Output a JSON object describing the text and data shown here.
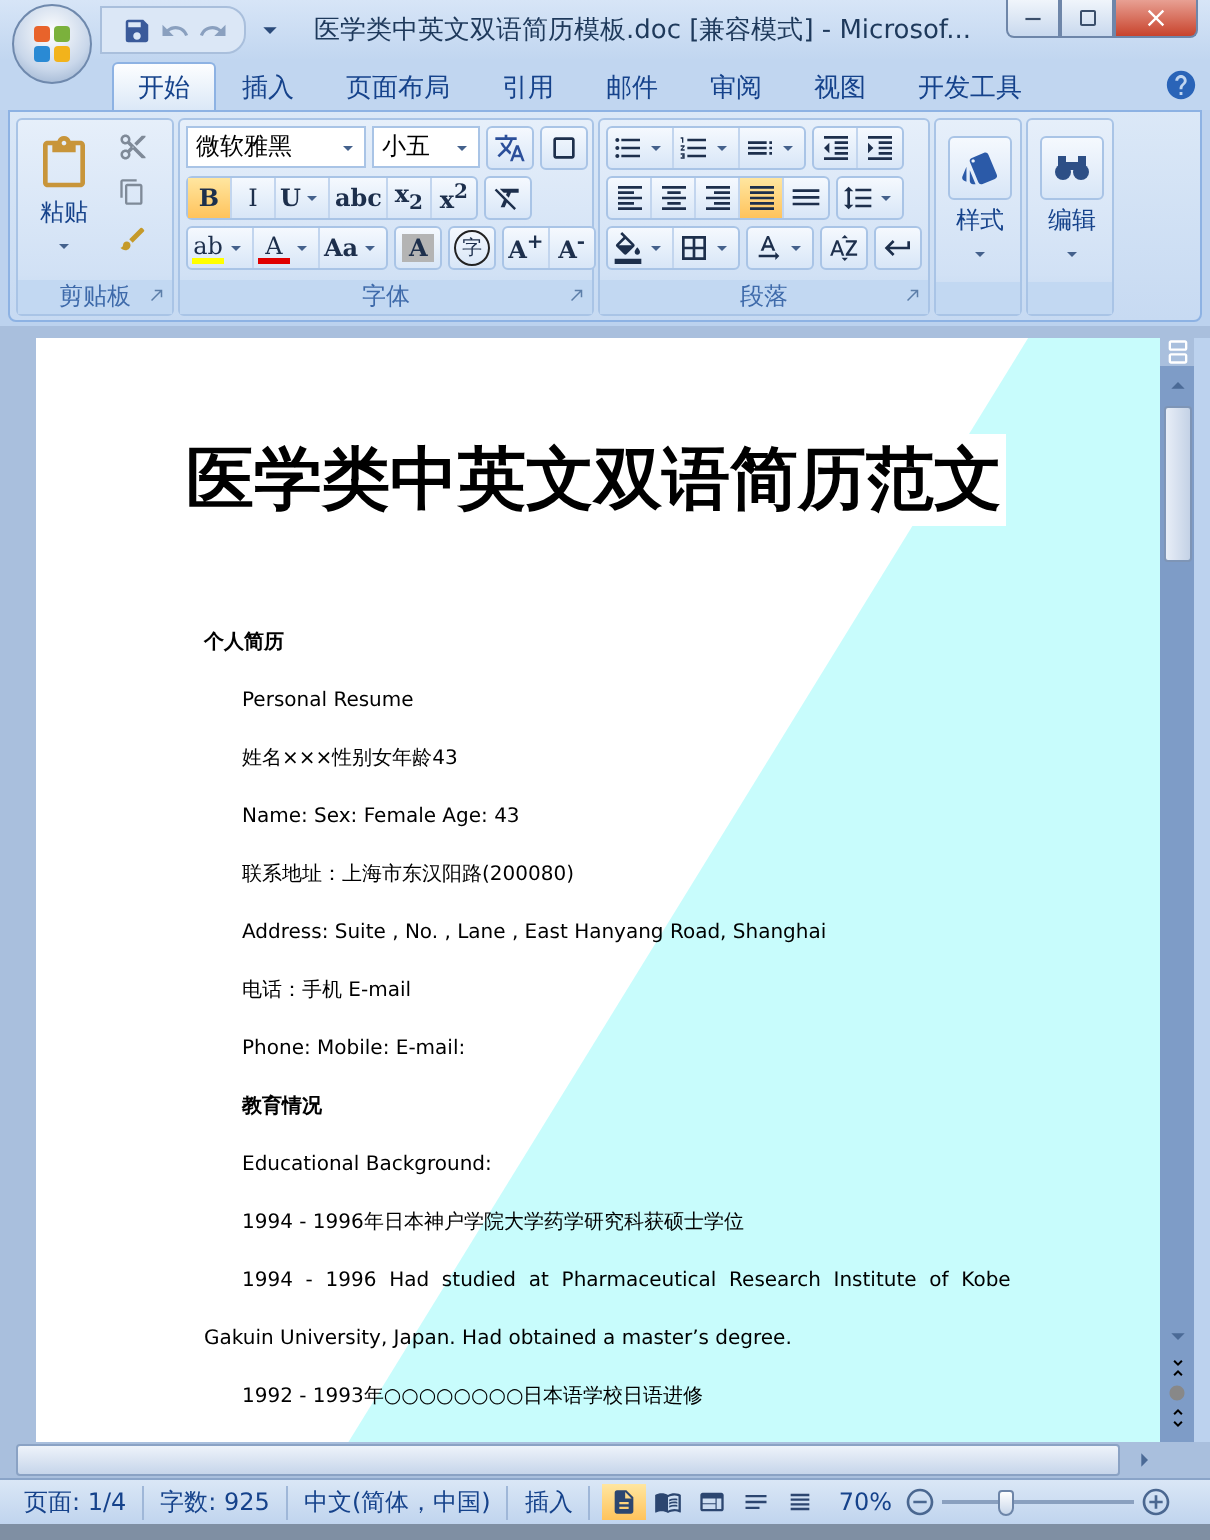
{
  "window": {
    "title": "医学类中英文双语简历模板.doc [兼容模式] - Microsof..."
  },
  "tabs": [
    {
      "label": "开始",
      "selected": true
    },
    {
      "label": "插入",
      "selected": false
    },
    {
      "label": "页面布局",
      "selected": false
    },
    {
      "label": "引用",
      "selected": false
    },
    {
      "label": "邮件",
      "selected": false
    },
    {
      "label": "审阅",
      "selected": false
    },
    {
      "label": "视图",
      "selected": false
    },
    {
      "label": "开发工具",
      "selected": false
    }
  ],
  "ribbon": {
    "clipboard": {
      "label": "剪贴板",
      "paste": "粘贴"
    },
    "font": {
      "label": "字体",
      "font_name": "微软雅黑",
      "font_size": "小五",
      "row2": [
        {
          "kind": "glyph",
          "glyph": "B",
          "bold": true,
          "active": true,
          "dropdown": false
        },
        {
          "kind": "glyph",
          "glyph": "I",
          "bold": false,
          "active": false,
          "dropdown": false
        },
        {
          "kind": "glyph",
          "glyph": "U",
          "bold": true,
          "active": false,
          "dropdown": true
        },
        {
          "kind": "glyph",
          "glyph": "abc",
          "bold": true,
          "active": false,
          "dropdown": false
        },
        {
          "kind": "glyph",
          "glyph": "x$_{2}$",
          "bold": true,
          "active": false,
          "dropdown": false
        },
        {
          "kind": "glyph",
          "glyph": "x$^{2}$",
          "bold": true,
          "active": false,
          "dropdown": false
        }
      ],
      "row3": [
        {
          "kind": "highlight",
          "glyph": "ab",
          "bold": false,
          "active": false,
          "dropdown": true
        },
        {
          "kind": "color",
          "glyph": "A",
          "bold": false,
          "active": false,
          "dropdown": true
        },
        {
          "kind": "glyph",
          "glyph": "Aa",
          "bold": true,
          "active": false,
          "dropdown": true
        },
        {
          "kind": "shaded",
          "glyph": "A",
          "bold": true,
          "active": false,
          "dropdown": false
        },
        {
          "kind": "circled",
          "glyph": "字",
          "bold": false,
          "active": false,
          "dropdown": false
        },
        {
          "kind": "glyph",
          "glyph": "A$^{+}$",
          "bold": true,
          "active": false,
          "dropdown": false
        },
        {
          "kind": "glyph",
          "glyph": "A$^{-}$",
          "bold": true,
          "active": false,
          "dropdown": false
        }
      ]
    },
    "paragraph": {
      "label": "段落",
      "rows": [
        [
          {
            "kind": "bullets",
            "active": false,
            "dropdown": true
          },
          {
            "kind": "numbering",
            "active": false,
            "dropdown": true
          },
          {
            "kind": "multilevel",
            "active": false,
            "dropdown": true
          },
          {
            "kind": "indent-decrease",
            "active": false,
            "dropdown": false
          },
          {
            "kind": "indent-increase",
            "active": false,
            "dropdown": false
          }
        ],
        [
          {
            "kind": "align-left",
            "active": false,
            "dropdown": false
          },
          {
            "kind": "align-center",
            "active": false,
            "dropdown": false
          },
          {
            "kind": "align-right",
            "active": false,
            "dropdown": false
          },
          {
            "kind": "justify",
            "active": true,
            "dropdown": false
          },
          {
            "kind": "distributed",
            "active": false,
            "dropdown": false
          },
          {
            "kind": "line-spacing",
            "active": false,
            "dropdown": true
          }
        ],
        [
          {
            "kind": "shading",
            "active": false,
            "dropdown": true
          },
          {
            "kind": "borders",
            "active": false,
            "dropdown": true
          },
          {
            "kind": "asian-layout",
            "active": false,
            "dropdown": true
          },
          {
            "kind": "sort",
            "active": false,
            "dropdown": false
          },
          {
            "kind": "marks",
            "active": false,
            "dropdown": false
          }
        ]
      ]
    },
    "styles": {
      "label": "样式"
    },
    "editing": {
      "label": "编辑"
    }
  },
  "document": {
    "title": "医学类中英文双语简历范文",
    "paragraphs": [
      {
        "text": "个人简历",
        "bold": true,
        "indent": false
      },
      {
        "text": "Personal Resume",
        "bold": false,
        "indent": true
      },
      {
        "text": "姓名×××性别女年龄43",
        "bold": false,
        "indent": true
      },
      {
        "text": "Name: Sex: Female Age: 43",
        "bold": false,
        "indent": true
      },
      {
        "text": "联系地址：上海市东汉阳路(200080)",
        "bold": false,
        "indent": true
      },
      {
        "text": "Address: Suite , No. , Lane , East Hanyang Road, Shanghai",
        "bold": false,
        "indent": true
      },
      {
        "text": "电话：手机 E-mail",
        "bold": false,
        "indent": true
      },
      {
        "text": "Phone: Mobile: E-mail:",
        "bold": false,
        "indent": true
      },
      {
        "text": "教育情况",
        "bold": true,
        "indent": true
      },
      {
        "text": "Educational Background:",
        "bold": false,
        "indent": true
      },
      {
        "text": "1994 - 1996年日本神户学院大学药学研究科获硕士学位",
        "bold": false,
        "indent": true
      },
      {
        "text": "1994  -  1996  Had  studied  at  Pharmaceutical  Research  Institute  of  Kobe",
        "bold": false,
        "indent": true
      },
      {
        "text": "Gakuin University, Japan. Had obtained a master’s degree.",
        "bold": false,
        "indent": false
      },
      {
        "text": "1992 - 1993年○○○○○○○○日本语学校日语进修",
        "bold": false,
        "indent": true
      }
    ]
  },
  "status_bar": {
    "items": [
      "页面: 1/4",
      "字数: 925",
      "中文(简体，中国)",
      "插入"
    ],
    "views": [
      {
        "kind": "print",
        "selected": true
      },
      {
        "kind": "reading",
        "selected": false
      },
      {
        "kind": "web",
        "selected": false
      },
      {
        "kind": "outline",
        "selected": false
      },
      {
        "kind": "draft",
        "selected": false
      }
    ],
    "zoom": "70%",
    "zoom_level": {
      "level": 0.33
    }
  }
}
